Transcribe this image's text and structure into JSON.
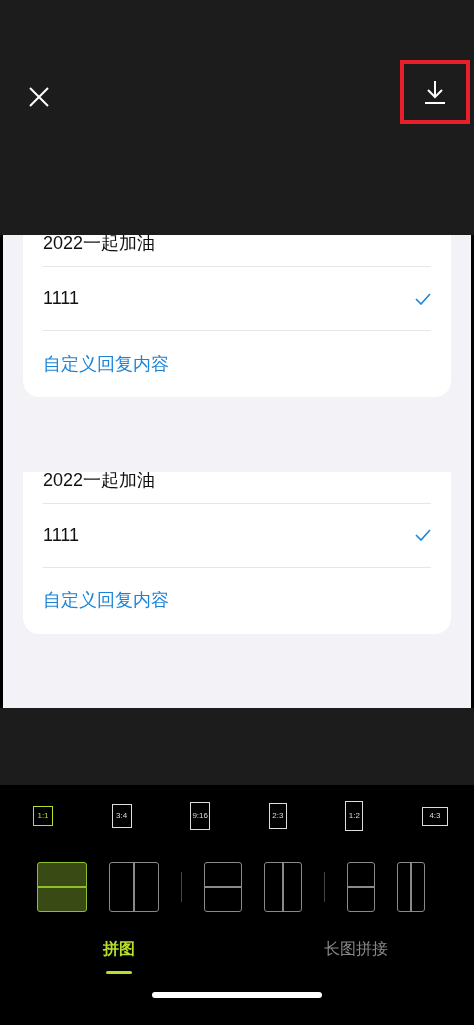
{
  "top_bar": {
    "download_highlighted": true
  },
  "panels": [
    {
      "rows": [
        {
          "text": "2022一起加油",
          "checked": false
        },
        {
          "text": "1111",
          "checked": true
        }
      ],
      "link": "自定义回复内容"
    },
    {
      "rows": [
        {
          "text": "2022一起加油",
          "checked": false
        },
        {
          "text": "1111",
          "checked": true
        }
      ],
      "link": "自定义回复内容"
    }
  ],
  "ratios": [
    {
      "label": "1:1",
      "selected": true
    },
    {
      "label": "3:4",
      "selected": false
    },
    {
      "label": "9:16",
      "selected": false
    },
    {
      "label": "2:3",
      "selected": false
    },
    {
      "label": "1:2",
      "selected": false
    },
    {
      "label": "4:3",
      "selected": false
    }
  ],
  "layouts": [
    {
      "kind": "rows",
      "selected": true
    },
    {
      "kind": "columns",
      "selected": false
    },
    {
      "kind": "rows",
      "selected": false
    },
    {
      "kind": "columns",
      "selected": false
    },
    {
      "kind": "rows",
      "selected": false
    },
    {
      "kind": "columns",
      "selected": false
    }
  ],
  "tabs": [
    {
      "label": "拼图",
      "selected": true
    },
    {
      "label": "长图拼接",
      "selected": false
    }
  ]
}
